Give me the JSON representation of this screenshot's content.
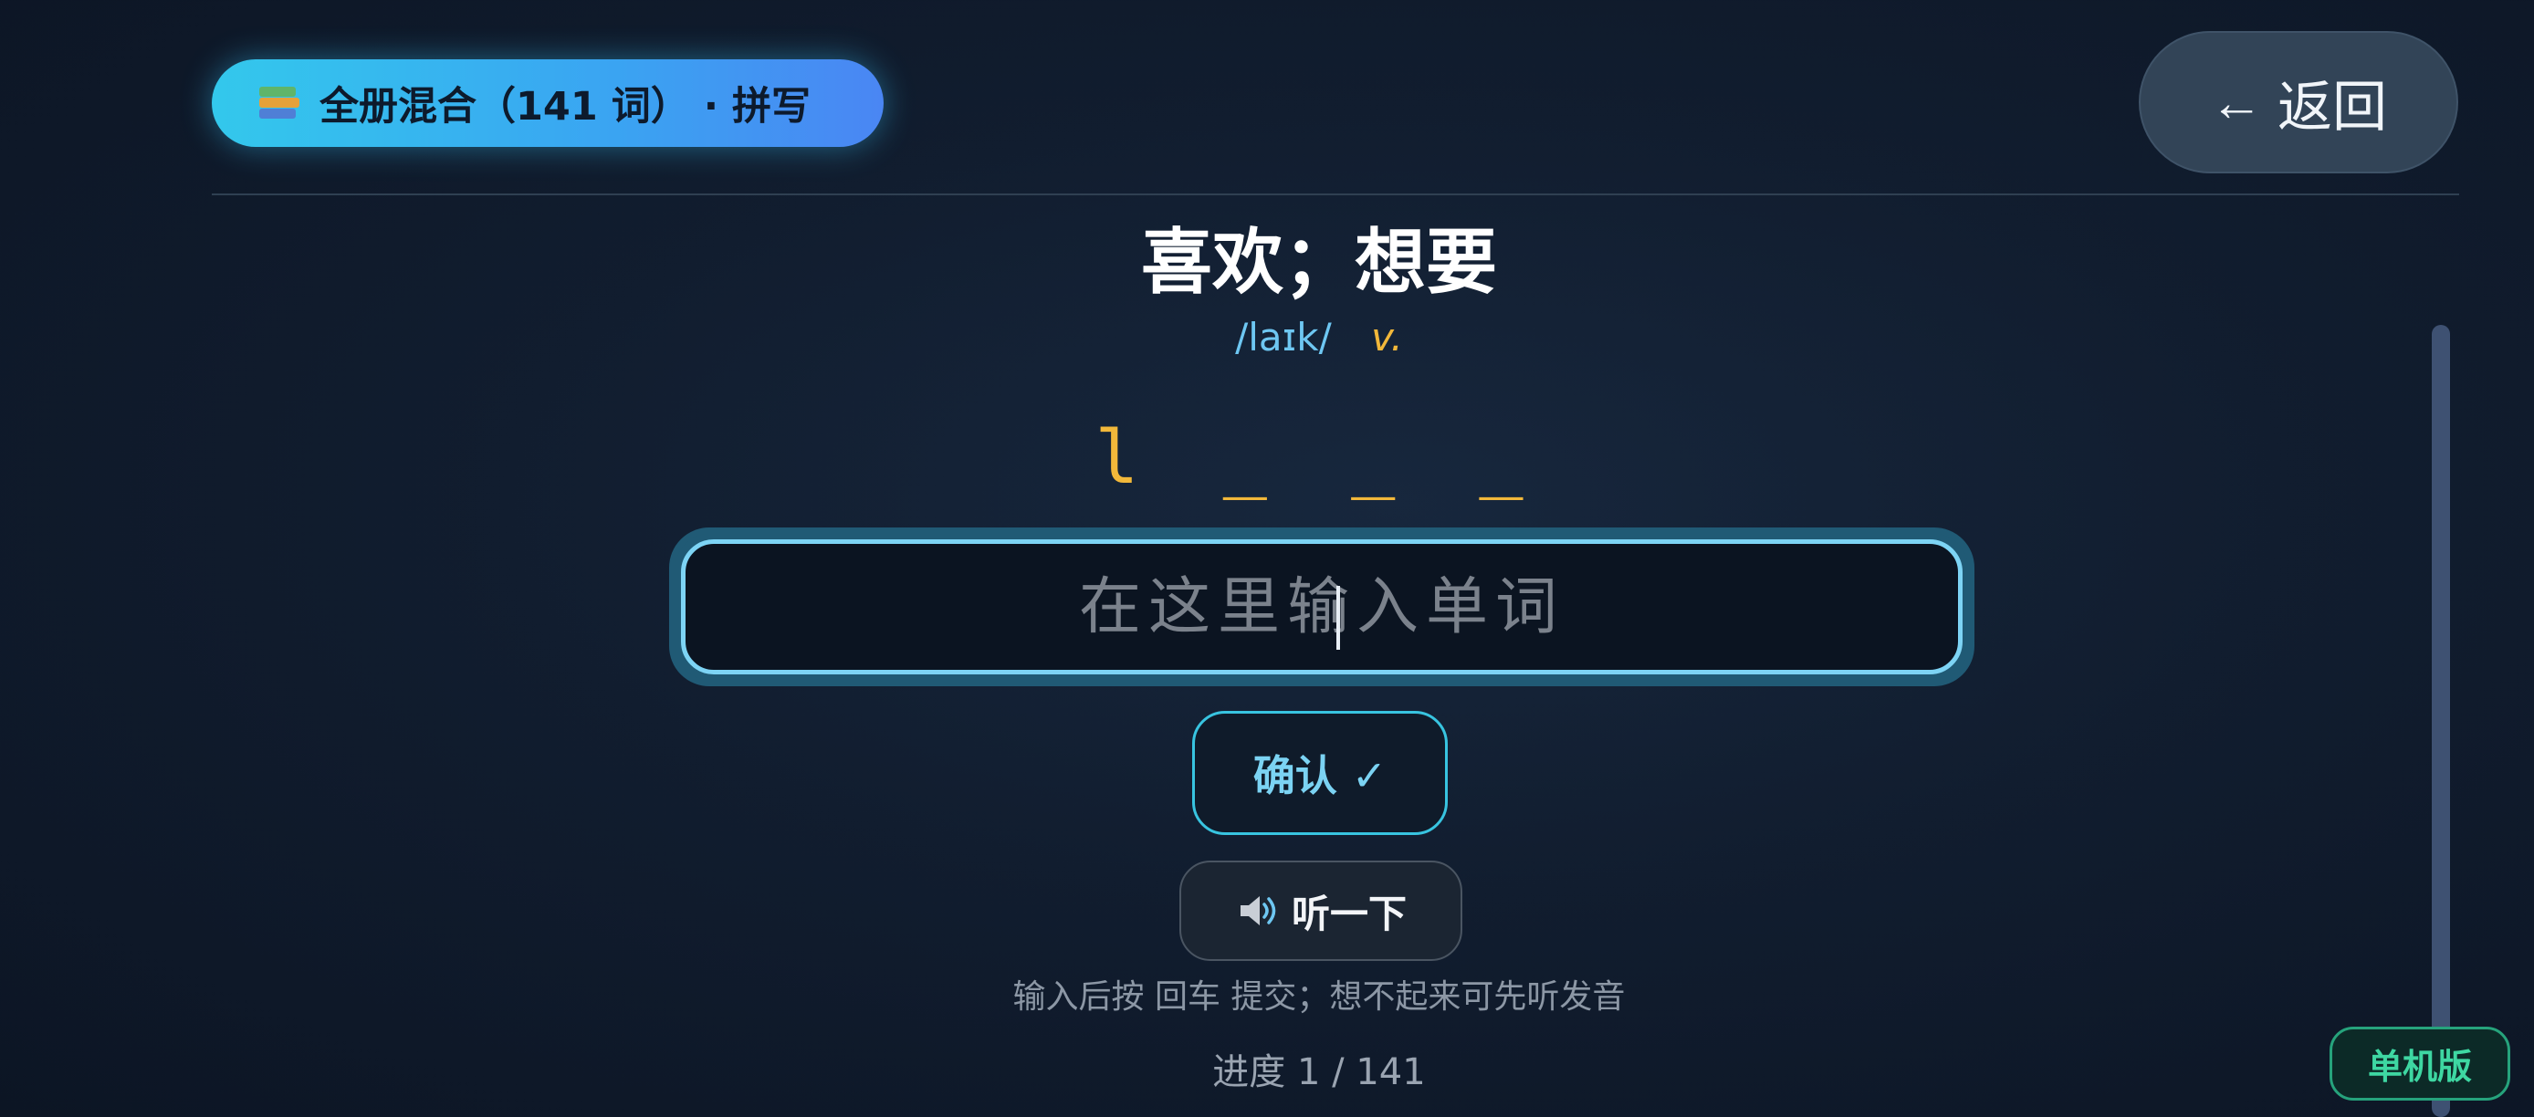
{
  "header": {
    "deck_icon": "books-icon",
    "deck_label": "全册混合（141 词） · 拼写",
    "back_icon": "arrow-left-icon",
    "back_label": "返回"
  },
  "word": {
    "meaning": "喜欢；想要",
    "phonetic": "/laɪk/",
    "pos": "v.",
    "hint": "l _ _ _"
  },
  "input": {
    "placeholder": "在这里输入单词",
    "value": ""
  },
  "actions": {
    "confirm_label": "确认 ✓",
    "listen_icon": "speaker-icon",
    "listen_label": "听一下"
  },
  "tip": "输入后按 回车 提交；想不起来可先听发音",
  "progress": {
    "label": "进度 1 / 141",
    "current": 1,
    "total": 141
  },
  "mode_badge": "单机版",
  "colors": {
    "accent": "#38c4e0",
    "hint": "#f2b83a",
    "phonetic": "#6ec7f2",
    "offline": "#3ed7a2"
  }
}
